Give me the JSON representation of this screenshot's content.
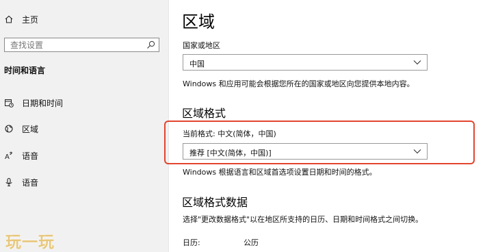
{
  "sidebar": {
    "home_label": "主页",
    "search_placeholder": "查找设置",
    "section_title": "时间和语言",
    "items": [
      {
        "label": "日期和时间",
        "icon": "calendar-clock-icon"
      },
      {
        "label": "区域",
        "icon": "globe-icon"
      },
      {
        "label": "语音",
        "icon": "speech-icon"
      },
      {
        "label": "语音",
        "icon": "microphone-icon"
      }
    ],
    "watermark": "玩一玩"
  },
  "main": {
    "title": "区域",
    "country": {
      "label": "国家或地区",
      "value": "中国",
      "description": "Windows 和应用可能会根据您所在的国家或地区向您提供本地内容。"
    },
    "format": {
      "title": "区域格式",
      "current_label": "当前格式: 中文(简体，中国)",
      "value": "推荐 [中文(简体，中国)]",
      "description": "Windows 根据语言和区域首选项设置日期和时间的格式。"
    },
    "format_data": {
      "title": "区域格式数据",
      "description": "选择\"更改数据格式\"以在地区所支持的日历、日期和时间格式之间切换。",
      "calendar_label": "日历:",
      "calendar_value": "公历"
    }
  },
  "colors": {
    "sidebar_bg": "#f1f1f1",
    "highlight_border": "#e2442f"
  }
}
